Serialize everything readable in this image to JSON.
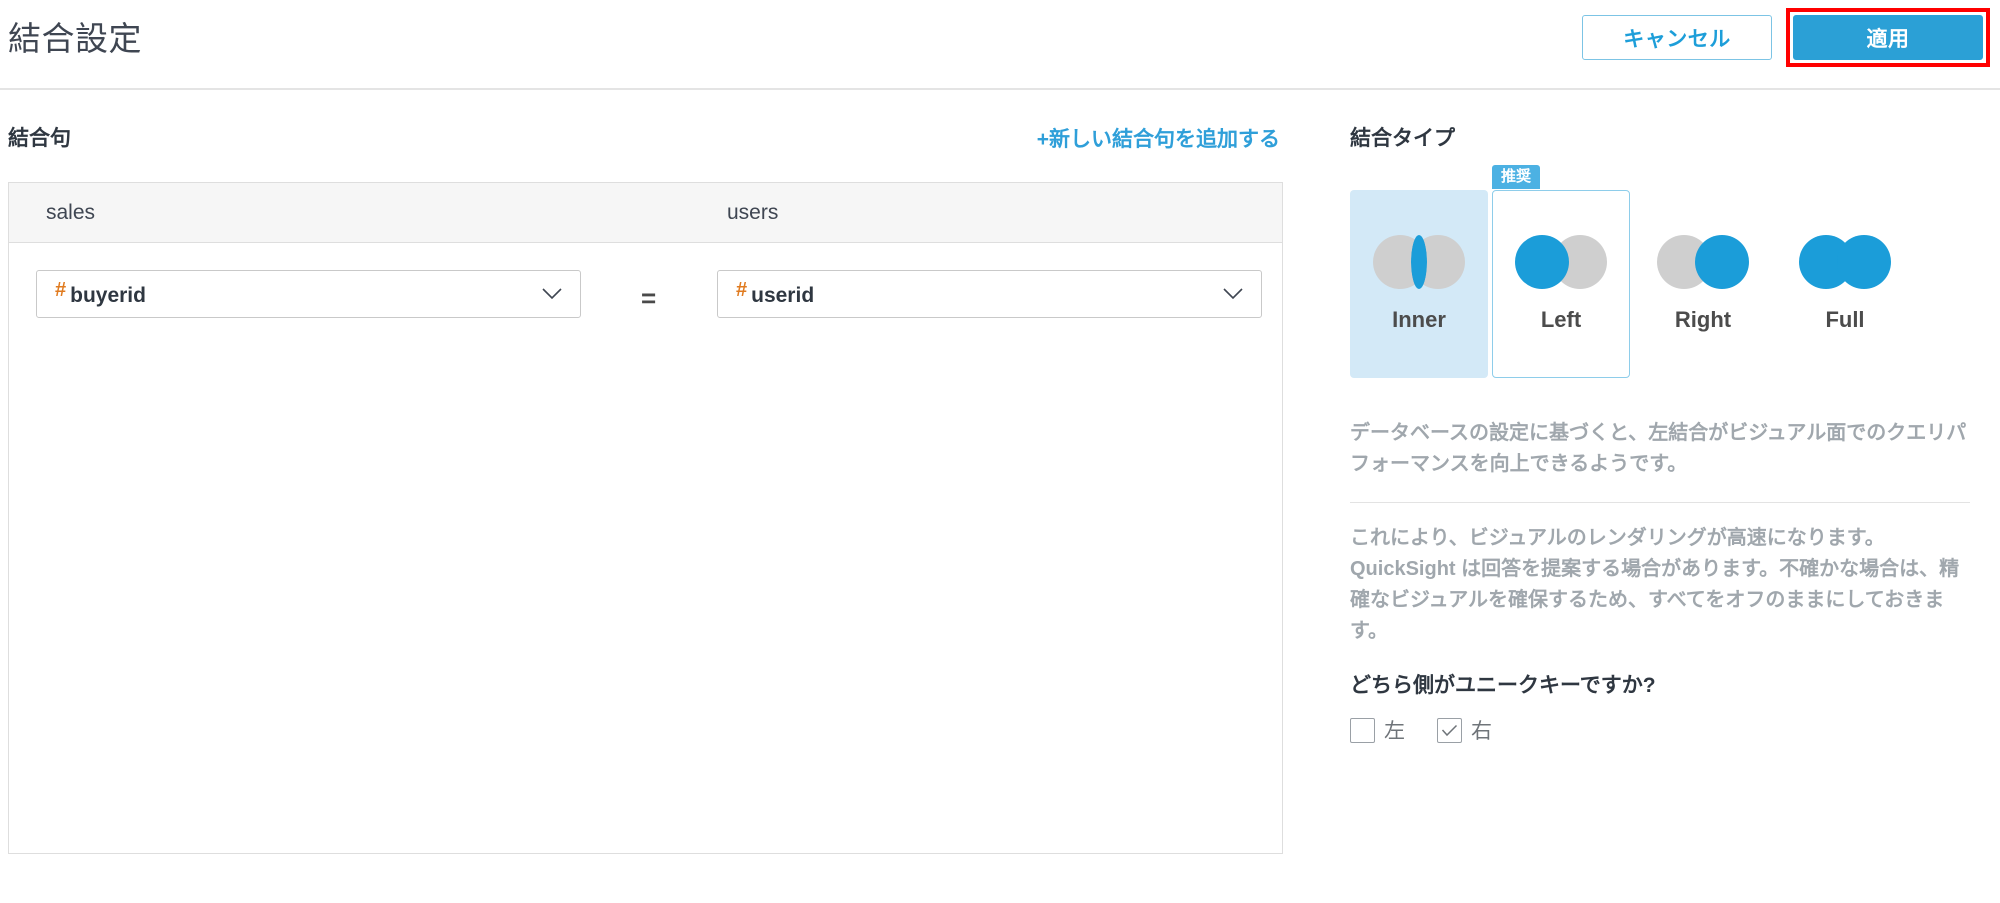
{
  "header": {
    "title": "結合設定",
    "cancel_label": "キャンセル",
    "apply_label": "適用"
  },
  "clauses": {
    "section_label": "結合句",
    "add_link_label": "+新しい結合句を追加する",
    "left_table": "sales",
    "right_table": "users",
    "operator": "=",
    "rows": [
      {
        "left_field": "buyerid",
        "left_type_icon": "hash-numeric-icon",
        "left_type_glyph": "#",
        "right_field": "userid",
        "right_type_icon": "hash-numeric-icon",
        "right_type_glyph": "#"
      }
    ]
  },
  "join_type": {
    "title": "結合タイプ",
    "recommended_badge": "推奨",
    "selected": "Inner",
    "recommended": "Left",
    "options": [
      {
        "label": "Inner",
        "icon": "venn-inner-icon",
        "state": "selected"
      },
      {
        "label": "Left",
        "icon": "venn-left-icon",
        "state": "recommended"
      },
      {
        "label": "Right",
        "icon": "venn-right-icon",
        "state": "normal"
      },
      {
        "label": "Full",
        "icon": "venn-full-icon",
        "state": "normal"
      }
    ],
    "hint_primary": "データベースの設定に基づくと、左結合がビジュアル面でのクエリパフォーマンスを向上できるようです。",
    "hint_secondary": "これにより、ビジュアルのレンダリングが高速になります。QuickSight は回答を提案する場合があります。不確かな場合は、精確なビジュアルを確保するため、すべてをオフのままにしておきます。",
    "unique_key_question": "どちら側がユニークキーですか?",
    "checkboxes": [
      {
        "label": "左",
        "checked": false
      },
      {
        "label": "右",
        "checked": true
      }
    ]
  },
  "colors": {
    "accent_blue": "#2ba0d6",
    "link_blue": "#2f9fd9",
    "venn_blue": "#1b9dd9",
    "venn_gray": "#cfcfcf",
    "selected_bg": "#d3e9f7",
    "annotation_red": "#ff0000",
    "numeric_type_orange": "#e07b20"
  }
}
